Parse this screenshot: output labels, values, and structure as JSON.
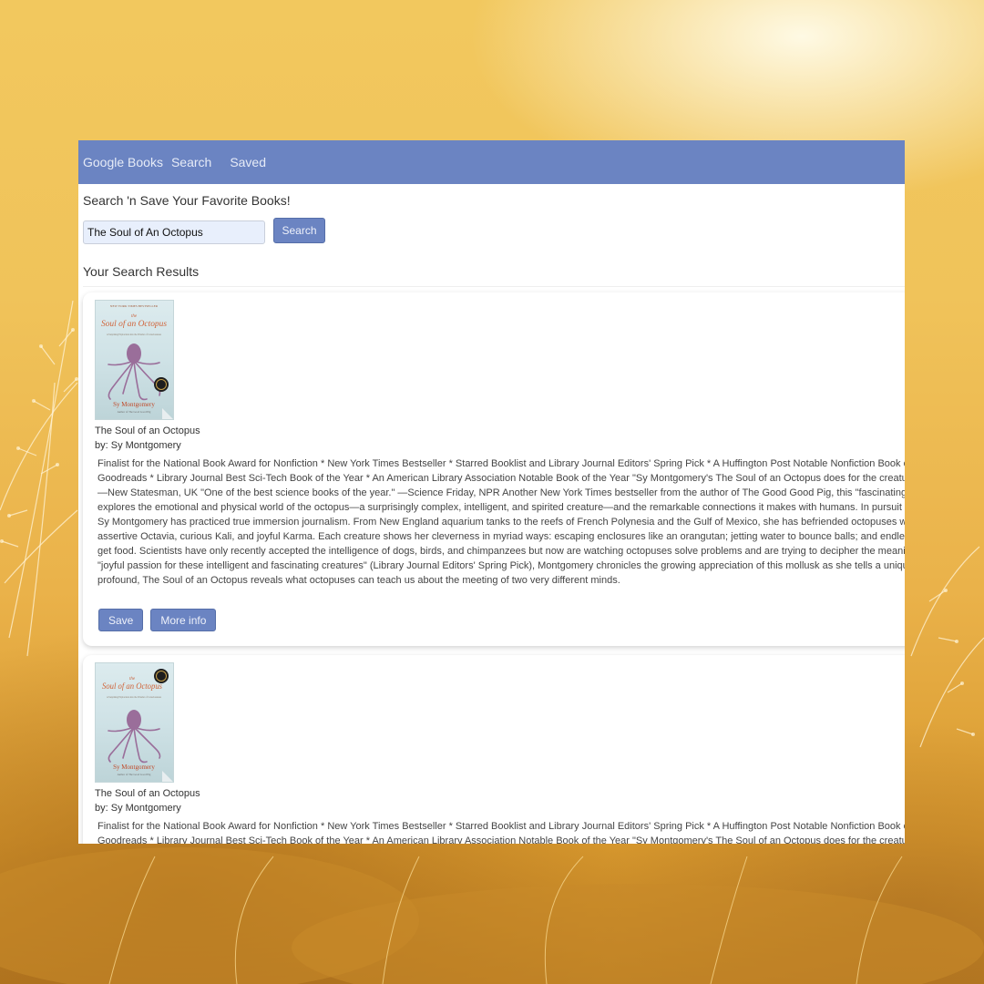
{
  "navbar": {
    "brand": "Google Books",
    "links": [
      "Search",
      "Saved"
    ]
  },
  "main": {
    "heading": "Search 'n Save Your Favorite Books!",
    "search": {
      "value": "The Soul of An Octopus",
      "button_label": "Search"
    },
    "results_heading": "Your Search Results"
  },
  "results": [
    {
      "title": "The Soul of an Octopus",
      "authors": "by: Sy Montgomery",
      "cover": {
        "banner": "NEW YORK TIMES BESTSELLER",
        "the": "the",
        "title": "Soul of an Octopus",
        "subtitle": "A Surprising Exploration into the Wonder of Consciousness",
        "author": "Sy Montgomery",
        "author_note": "Author of The Good Good Pig"
      },
      "description_lines": [
        "Finalist for the National Book Award for Nonfiction * New York Times Bestseller * Starred Booklist and Library Journal Editors' Spring Pick * A Huffington Post Notable Nonfiction Book of",
        "Goodreads * Library Journal Best Sci-Tech Book of the Year * An American Library Association Notable Book of the Year \"Sy Montgomery's The Soul of an Octopus does for the creature",
        "—New Statesman, UK \"One of the best science books of the year.\" —Science Friday, NPR Another New York Times bestseller from the author of The Good Good Pig, this \"fascinating…to",
        "explores the emotional and physical world of the octopus—a surprisingly complex, intelligent, and spirited creature—and the remarkable connections it makes with humans. In pursuit of",
        "Sy Montgomery has practiced true immersion journalism. From New England aquarium tanks to the reefs of French Polynesia and the Gulf of Mexico, she has befriended octopuses with",
        "assertive Octavia, curious Kali, and joyful Karma. Each creature shows her cleverness in myriad ways: escaping enclosures like an orangutan; jetting water to bounce balls; and endlessly",
        "get food. Scientists have only recently accepted the intelligence of dogs, birds, and chimpanzees but now are watching octopuses solve problems and are trying to decipher the meaning",
        "\"joyful passion for these intelligent and fascinating creatures\" (Library Journal Editors' Spring Pick), Montgomery chronicles the growing appreciation of this mollusk as she tells a unique",
        "profound, The Soul of an Octopus reveals what octopuses can teach us about the meeting of two very different minds."
      ],
      "save_label": "Save",
      "more_label": "More info"
    },
    {
      "title": "The Soul of an Octopus",
      "authors": "by: Sy Montgomery",
      "cover": {
        "banner": "",
        "the": "the",
        "title": "Soul of an Octopus",
        "subtitle": "A Surprising Exploration into the Wonder of Consciousness",
        "author": "Sy Montgomery",
        "author_note": "Author of The Good Good Pig"
      },
      "description_lines": [
        "Finalist for the National Book Award for Nonfiction * New York Times Bestseller * Starred Booklist and Library Journal Editors' Spring Pick * A Huffington Post Notable Nonfiction Book of",
        "Goodreads * Library Journal Best Sci-Tech Book of the Year * An American Library Association Notable Book of the Year \"Sy Montgomery's The Soul of an Octopus does for the creature"
      ]
    }
  ]
}
